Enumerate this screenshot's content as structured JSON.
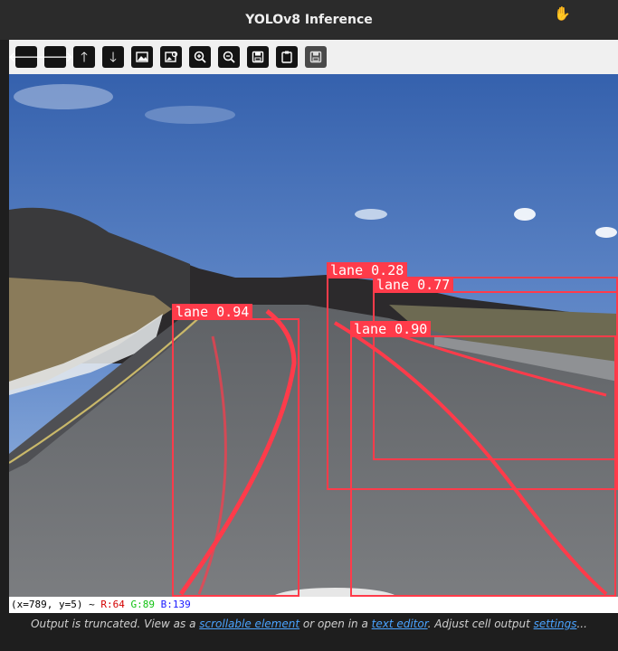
{
  "window": {
    "title": "YOLOv8 Inference",
    "cursor_icon": "hand-icon"
  },
  "toolbar": {
    "buttons": [
      {
        "name": "back-button",
        "icon": "arrow-left-icon"
      },
      {
        "name": "forward-button",
        "icon": "arrow-right-icon"
      },
      {
        "name": "up-button",
        "icon": "arrow-up-icon"
      },
      {
        "name": "down-button",
        "icon": "arrow-down-icon"
      },
      {
        "name": "image-button",
        "icon": "image-icon"
      },
      {
        "name": "image-settings-button",
        "icon": "image-gear-icon"
      },
      {
        "name": "zoom-in-button",
        "icon": "zoom-in-icon"
      },
      {
        "name": "zoom-out-button",
        "icon": "zoom-out-icon"
      },
      {
        "name": "save-button",
        "icon": "floppy-icon"
      },
      {
        "name": "clipboard-button",
        "icon": "clipboard-icon"
      },
      {
        "name": "save-alt-button",
        "icon": "floppy-icon"
      }
    ]
  },
  "detections": [
    {
      "label": "lane 0.94"
    },
    {
      "label": "lane 0.28"
    },
    {
      "label": "lane 0.77"
    },
    {
      "label": "lane 0.90"
    }
  ],
  "status": {
    "coords": "(x=789, y=5) ~",
    "r": "R:64",
    "g": "G:89",
    "b": "B:139"
  },
  "output_note": {
    "prefix": "Output is truncated. View as a ",
    "link1": "scrollable element",
    "middle": " or open in a ",
    "link2": "text editor",
    "middle2": ". Adjust cell output ",
    "link3": "settings",
    "suffix": "..."
  },
  "colors": {
    "box": "#ff3b4a",
    "sky": "#3f6fb5"
  }
}
